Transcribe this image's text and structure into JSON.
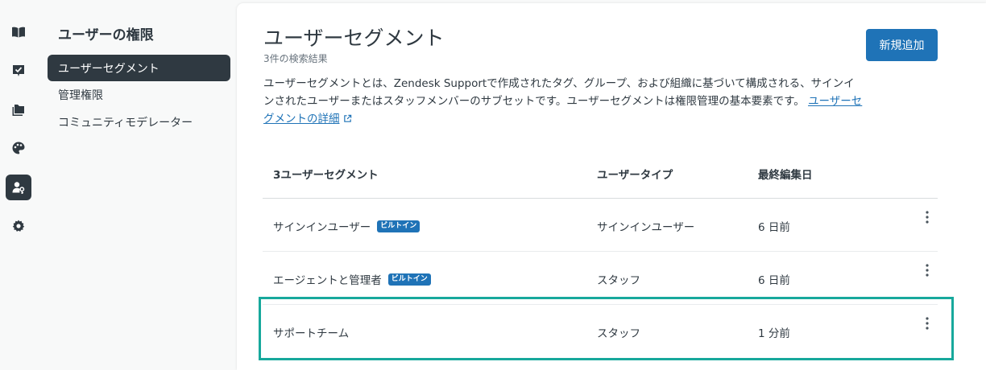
{
  "rail": {
    "items": [
      {
        "icon": "book-icon",
        "active": false
      },
      {
        "icon": "ticket-check-icon",
        "active": false
      },
      {
        "icon": "folder-icon",
        "active": false
      },
      {
        "icon": "palette-icon",
        "active": false
      },
      {
        "icon": "user-permissions-icon",
        "active": true
      },
      {
        "icon": "gear-icon",
        "active": false
      }
    ]
  },
  "subnav": {
    "title": "ユーザーの権限",
    "items": [
      {
        "label": "ユーザーセグメント",
        "active": true
      },
      {
        "label": "管理権限",
        "active": false
      },
      {
        "label": "コミュニティモデレーター",
        "active": false
      }
    ]
  },
  "main": {
    "title": "ユーザーセグメント",
    "result_count": "3件の検索結果",
    "add_button": "新規追加",
    "description": "ユーザーセグメントとは、Zendesk Supportで作成されたタグ、グループ、および組織に基づいて構成される、サインインされたユーザーまたはスタッフメンバーのサブセットです。ユーザーセグメントは権限管理の基本要素です。",
    "description_link": "ユーザーセグメントの詳細"
  },
  "table": {
    "headers": [
      "3ユーザーセグメント",
      "ユーザータイプ",
      "最終編集日"
    ],
    "rows": [
      {
        "name": "サインインユーザー",
        "badge": "ビルトイン",
        "type": "サインインユーザー",
        "edited": "6 日前"
      },
      {
        "name": "エージェントと管理者",
        "badge": "ビルトイン",
        "type": "スタッフ",
        "edited": "6 日前"
      },
      {
        "name": "サポートチーム",
        "badge": "",
        "type": "スタッフ",
        "edited": "1 分前"
      }
    ]
  },
  "colors": {
    "accent": "#1f73b7",
    "nav_active": "#2f3941",
    "highlight": "#17a89c"
  }
}
